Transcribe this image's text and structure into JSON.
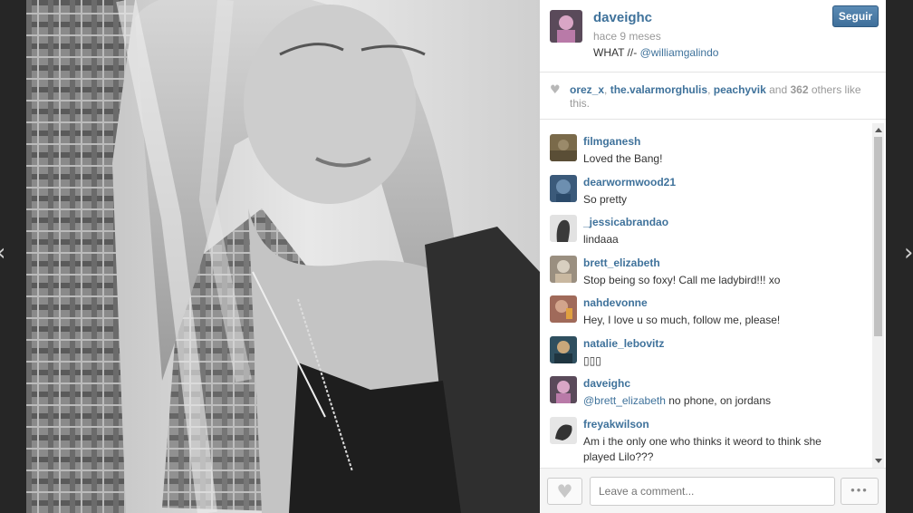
{
  "navigation": {
    "prev_glyph": "‹",
    "next_glyph": "›"
  },
  "photo": {
    "alt": "Black and white portrait photo"
  },
  "post": {
    "owner": "daveighc",
    "time": "hace 9 meses",
    "caption_text": "WHAT //- ",
    "caption_mention": "@williamgalindo",
    "follow_label": "Seguir"
  },
  "likes": {
    "heart_icon": "heart-icon",
    "users": [
      "orez_x",
      "the.valarmorghulis",
      "peachyvik"
    ],
    "separator": ", ",
    "and_text": " and ",
    "count": "362",
    "suffix": " others like this."
  },
  "comments": [
    {
      "user": "filmganesh",
      "text": "Loved the Bang!",
      "avatar_color": "#7a6a4a"
    },
    {
      "user": "dearwormwood21",
      "text": "So pretty",
      "avatar_color": "#3b5a7a"
    },
    {
      "user": "_jessicabrandao",
      "text": "lindaaa",
      "avatar_color": "#6b6b6b"
    },
    {
      "user": "brett_elizabeth",
      "text": "Stop being so foxy! Call me ladybird!!! xo",
      "avatar_color": "#9a8f80"
    },
    {
      "user": "nahdevonne",
      "text": "Hey, I love u so much, follow me, please!",
      "avatar_color": "#a06a5a"
    },
    {
      "user": "natalie_lebovitz",
      "text": "▯▯▯",
      "avatar_color": "#2f4f5f"
    },
    {
      "user": "daveighc",
      "mention": "@brett_elizabeth",
      "text": " no phone, on jordans",
      "avatar_color": "#7a3f6a"
    },
    {
      "user": "freyakwilson",
      "text": "Am i the only one who thinks it weord to think she played Lilo???",
      "avatar_color": "#444444"
    }
  ],
  "footer": {
    "like_glyph": "♥",
    "comment_placeholder": "Leave a comment...",
    "more_glyph": "•••"
  },
  "colors": {
    "link": "#3f729b",
    "follow_button": "#4d7eab"
  }
}
